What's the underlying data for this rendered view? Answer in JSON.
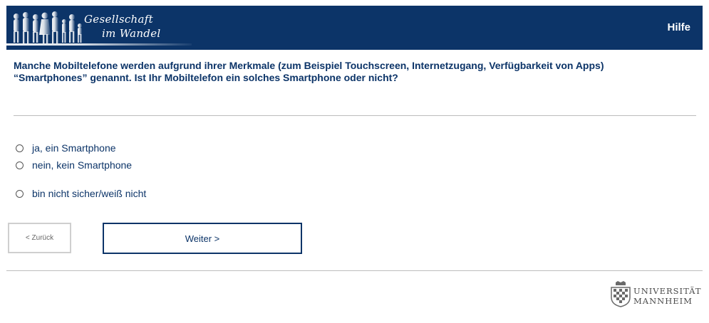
{
  "header": {
    "logo_line1": "Gesellschaft",
    "logo_line2": "im Wandel",
    "help_label": "Hilfe",
    "background_color": "#0c3468"
  },
  "question": {
    "line1": "Manche Mobiltelefone werden aufgrund ihrer Merkmale (zum Beispiel Touchscreen, Internetzugang, Verfügbarkeit von Apps)",
    "line2": "“Smartphones” genannt. Ist Ihr Mobiltelefon ein solches Smartphone oder nicht?"
  },
  "options": [
    {
      "label": "ja, ein Smartphone",
      "selected": false
    },
    {
      "label": "nein, kein Smartphone",
      "selected": false
    },
    {
      "label": "bin nicht sicher/weiß nicht",
      "selected": false
    }
  ],
  "navigation": {
    "back_label": "< Zurück",
    "next_label": "Weiter >"
  },
  "footer": {
    "university_line1": "UNIVERSITÄT",
    "university_line2": "MANNHEIM"
  }
}
